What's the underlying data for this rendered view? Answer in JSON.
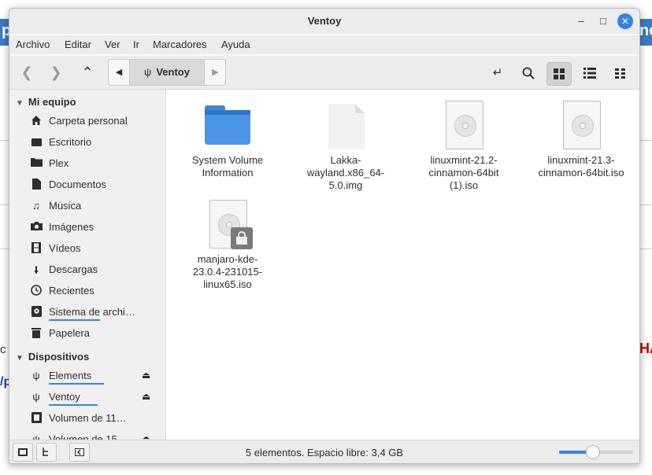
{
  "window": {
    "title": "Ventoy",
    "min_icon": "minimize-icon",
    "max_icon": "maximize-icon",
    "close_icon": "close-icon"
  },
  "menu": [
    "Archivo",
    "Editar",
    "Ver",
    "Ir",
    "Marcadores",
    "Ayuda"
  ],
  "toolbar": {
    "path_segment": "Ventoy",
    "icons": [
      "back-icon",
      "forward-icon",
      "up-icon",
      "toggle-location-icon",
      "search-icon",
      "grid-view-icon",
      "list-view-icon",
      "compact-view-icon"
    ]
  },
  "sidebar": {
    "section_mi_equipo": "Mi equipo",
    "section_dispositivos": "Dispositivos",
    "places": [
      {
        "label": "Carpeta personal",
        "icon": "home-icon"
      },
      {
        "label": "Escritorio",
        "icon": "desktop-icon"
      },
      {
        "label": "Plex",
        "icon": "folder-icon"
      },
      {
        "label": "Documentos",
        "icon": "document-icon"
      },
      {
        "label": "Música",
        "icon": "music-icon"
      },
      {
        "label": "Imágenes",
        "icon": "camera-icon"
      },
      {
        "label": "Vídeos",
        "icon": "film-icon"
      },
      {
        "label": "Descargas",
        "icon": "download-icon"
      },
      {
        "label": "Recientes",
        "icon": "clock-icon"
      },
      {
        "label": "Sistema de archi…",
        "icon": "drive-icon",
        "usage": 0.65
      },
      {
        "label": "Papelera",
        "icon": "trash-icon"
      }
    ],
    "devices": [
      {
        "label": "Elements",
        "icon": "usb-icon",
        "eject": true,
        "usage": 0.7
      },
      {
        "label": "Ventoy",
        "icon": "usb-icon",
        "eject": true,
        "usage": 0.62
      },
      {
        "label": "Volumen de 11…",
        "icon": "chip-icon",
        "eject": false
      },
      {
        "label": "Volumen de 15…",
        "icon": "usb-icon",
        "eject": true
      }
    ]
  },
  "files": [
    {
      "name": "System Volume Information",
      "type": "folder"
    },
    {
      "name": "Lakka-wayland.x86_64-5.0.img",
      "type": "file"
    },
    {
      "name": "linuxmint-21.2-cinnamon-64bit (1).iso",
      "type": "iso"
    },
    {
      "name": "linuxmint-21.3-cinnamon-64bit.iso",
      "type": "iso"
    },
    {
      "name": "manjaro-kde-23.0.4-231015-linux65.iso",
      "type": "iso-locked"
    }
  ],
  "status": {
    "text": "5 elementos. Espacio libre: 3,4 GB",
    "zoom_level": 0.45
  },
  "colors": {
    "accent": "#3584e4",
    "folder": "#4a95e6"
  }
}
